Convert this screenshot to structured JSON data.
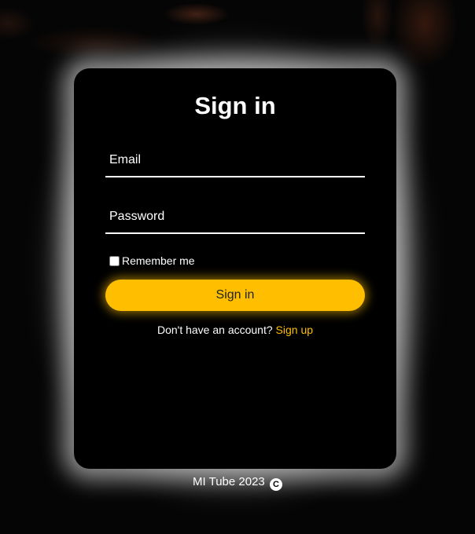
{
  "form": {
    "title": "Sign in",
    "email_placeholder": "Email",
    "password_placeholder": "Password",
    "remember_label": "Remember me",
    "remember_checked": false,
    "submit_label": "Sign in",
    "signup_prompt": "Don't have an account? ",
    "signup_link": "Sign up"
  },
  "footer": {
    "text": "MI Tube 2023",
    "icon": "copyright-icon",
    "icon_glyph": "C"
  },
  "colors": {
    "accent": "#ffbf00",
    "card_background": "#000000",
    "text": "#ffffff"
  }
}
